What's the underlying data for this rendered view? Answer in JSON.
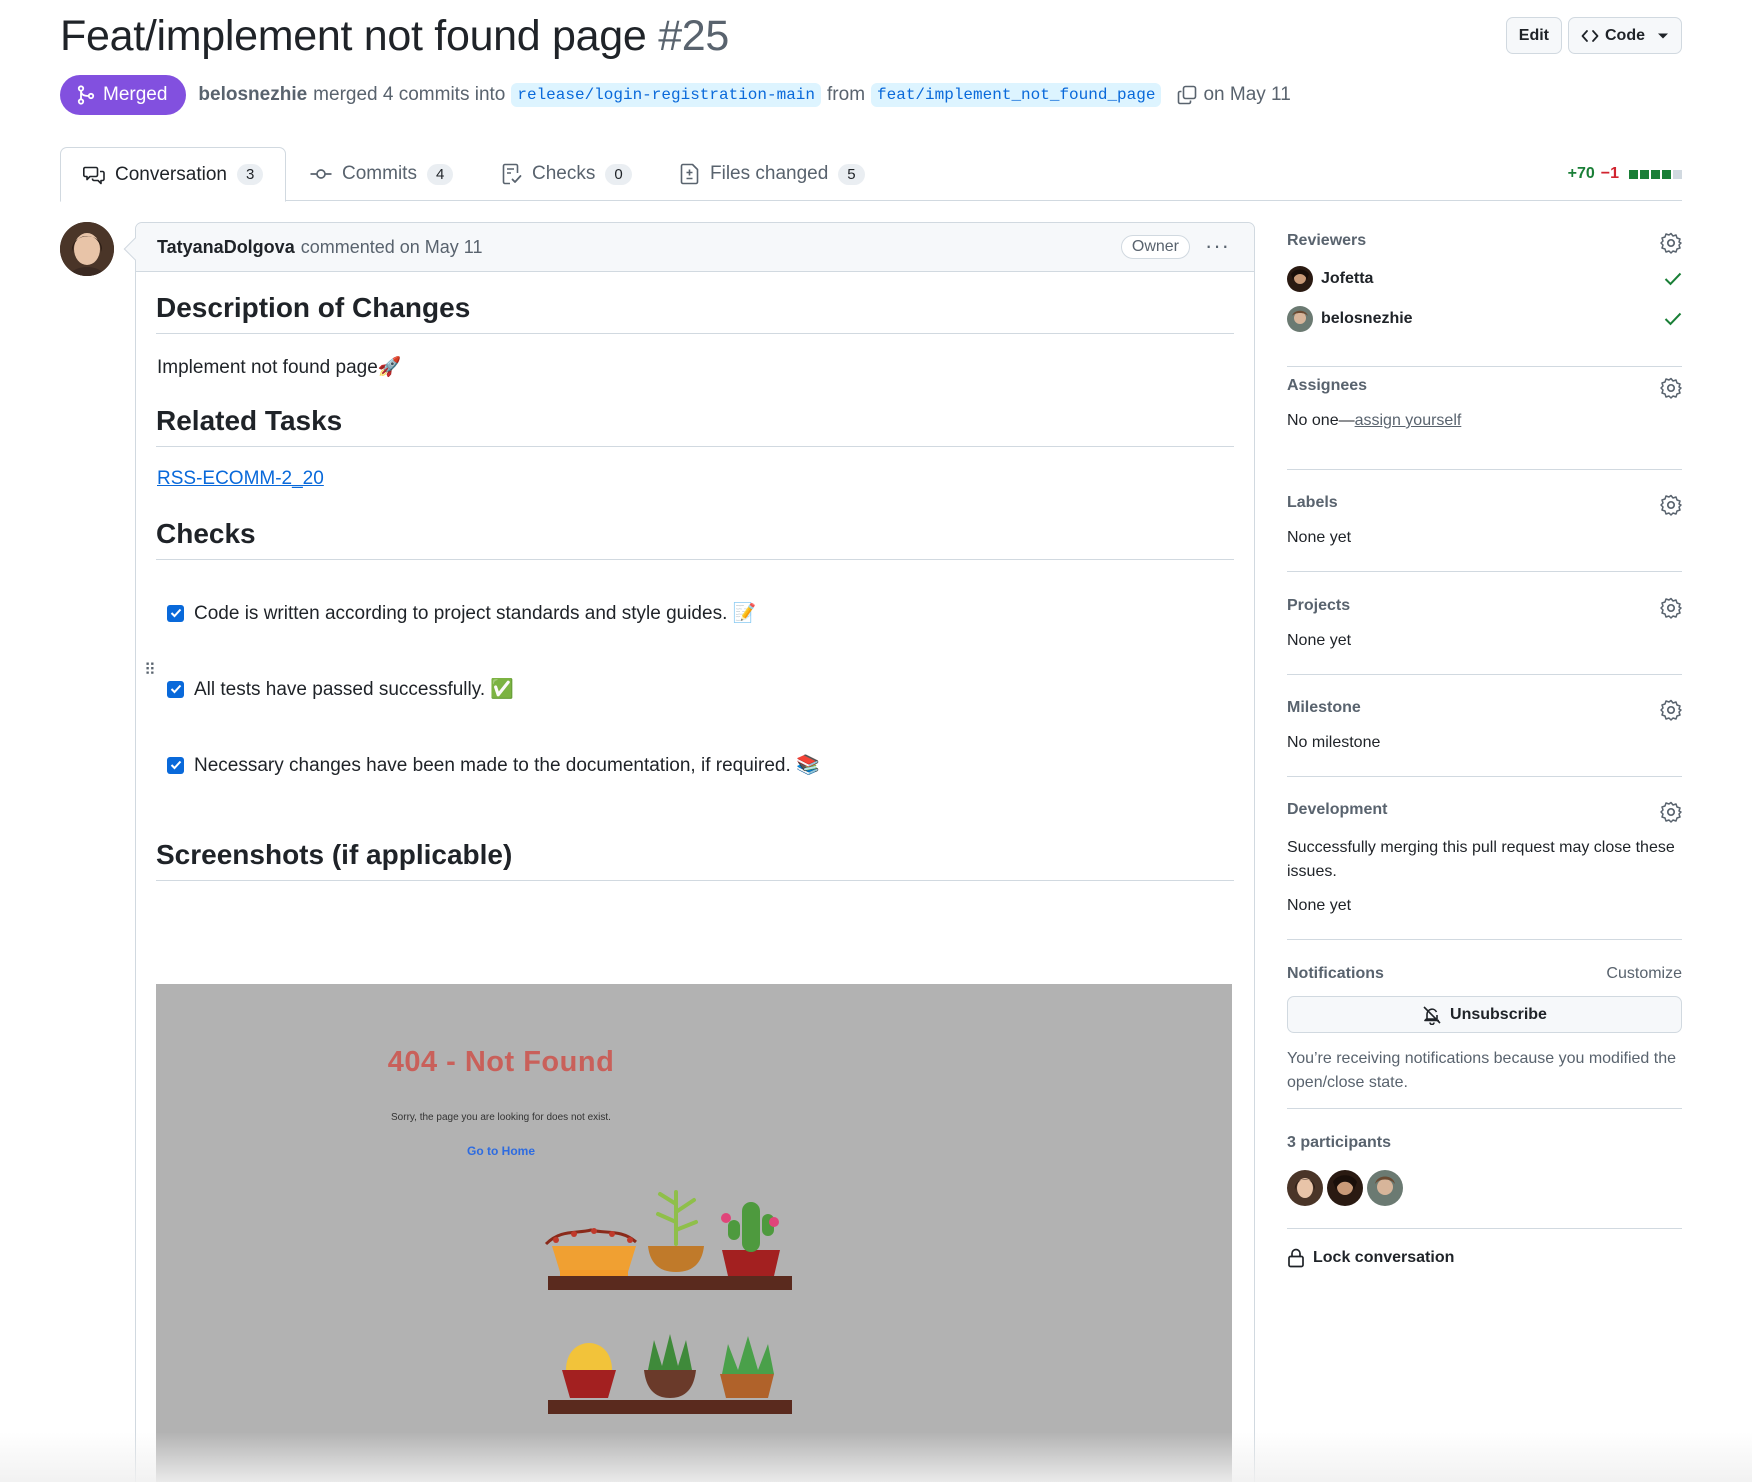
{
  "pr": {
    "title": "Feat/implement not found page",
    "number": "#25",
    "state": "Merged",
    "author": "belosnezhie",
    "merge_text_1": "merged 4 commits into",
    "base_branch": "release/login-registration-main",
    "from_text": "from",
    "head_branch": "feat/implement_not_found_page",
    "date_text": "on May 11"
  },
  "header_buttons": {
    "edit": "Edit",
    "code": "Code"
  },
  "tabs": [
    {
      "label": "Conversation",
      "count": "3",
      "icon": "comment-discussion-icon"
    },
    {
      "label": "Commits",
      "count": "4",
      "icon": "commit-icon"
    },
    {
      "label": "Checks",
      "count": "0",
      "icon": "checklist-icon"
    },
    {
      "label": "Files changed",
      "count": "5",
      "icon": "file-diff-icon"
    }
  ],
  "diffstat": {
    "additions": "+70",
    "deletions": "−1",
    "colors": [
      "#1a7f37",
      "#1a7f37",
      "#1a7f37",
      "#1a7f37",
      "#d1d9e0"
    ]
  },
  "comment": {
    "author": "TatyanaDolgova",
    "meta": "commented on May 11",
    "role": "Owner",
    "h_description": "Description of Changes",
    "description": "Implement not found page🚀",
    "h_related": "Related Tasks",
    "related_link": "RSS-ECOMM-2_20",
    "h_checks": "Checks",
    "checks": [
      "Code is written according to project standards and style guides. 📝",
      "All tests have passed successfully. ✅",
      "Necessary changes have been made to the documentation, if required. 📚"
    ],
    "h_screenshots": "Screenshots (if applicable)",
    "screenshot": {
      "title": "404 - Not Found",
      "text": "Sorry, the page you are looking for does not exist.",
      "link": "Go to Home"
    }
  },
  "sidebar": {
    "reviewers_title": "Reviewers",
    "reviewers": [
      {
        "name": "Jofetta"
      },
      {
        "name": "belosnezhie"
      }
    ],
    "assignees_title": "Assignees",
    "assignees_none": "No one—",
    "assignees_link": "assign yourself",
    "labels_title": "Labels",
    "labels_value": "None yet",
    "projects_title": "Projects",
    "projects_value": "None yet",
    "milestone_title": "Milestone",
    "milestone_value": "No milestone",
    "development_title": "Development",
    "development_text": "Successfully merging this pull request may close these issues.",
    "development_value": "None yet",
    "notifications_title": "Notifications",
    "notifications_customize": "Customize",
    "unsubscribe": "Unsubscribe",
    "notifications_reason": "You’re receiving notifications because you modified the open/close state.",
    "participants_title": "3 participants",
    "lock": "Lock conversation"
  },
  "colors": {
    "merged": "#8250df",
    "link": "#0969da",
    "check": "#1a7f37"
  }
}
